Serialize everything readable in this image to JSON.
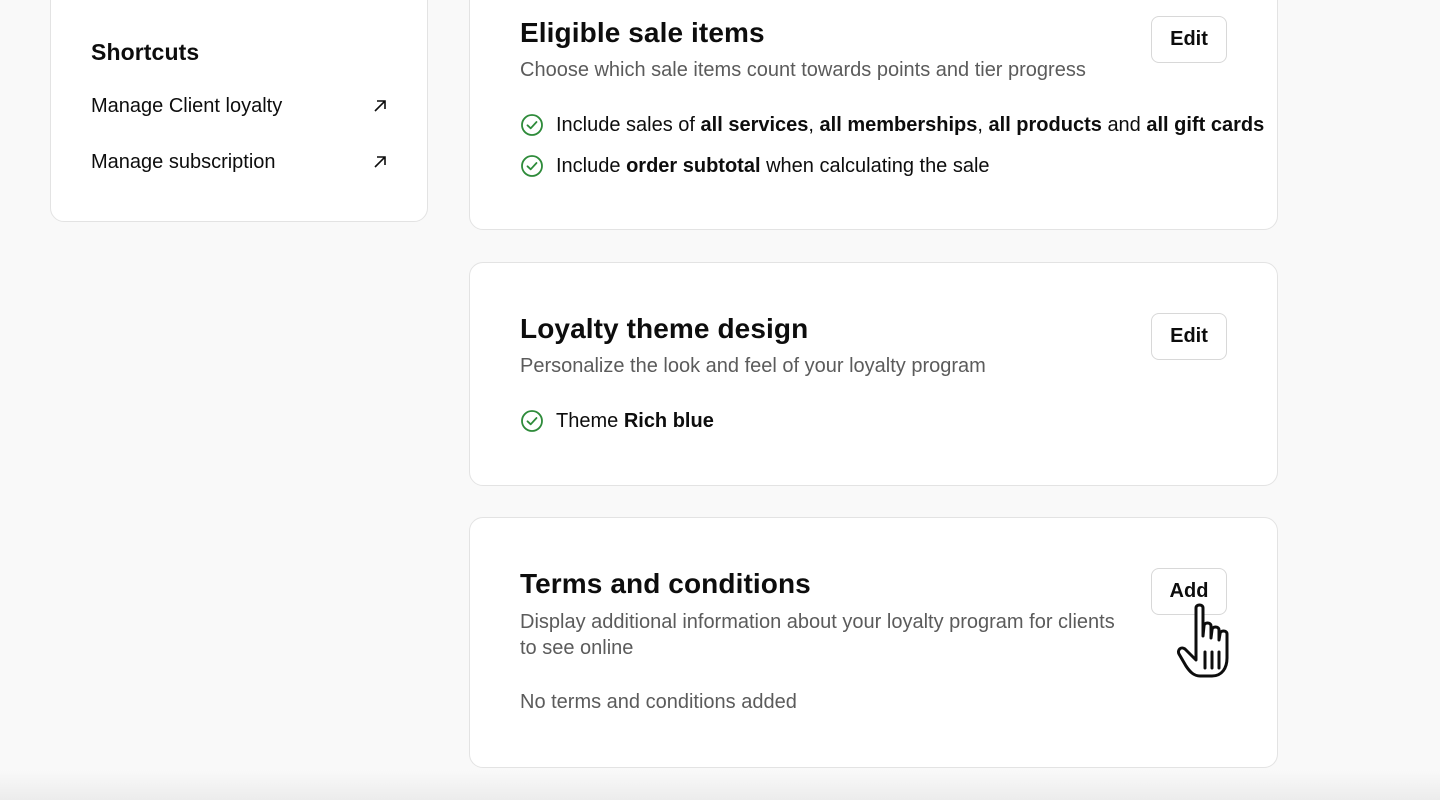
{
  "shortcuts": {
    "title": "Shortcuts",
    "items": [
      {
        "label": "Manage Client loyalty",
        "icon": "external-link-icon"
      },
      {
        "label": "Manage subscription",
        "icon": "external-link-icon"
      }
    ]
  },
  "eligible": {
    "title": "Eligible sale items",
    "description": "Choose which sale items count towards points and tier progress",
    "button": "Edit",
    "row1": {
      "prefix": "Include sales of",
      "services": "all services",
      "sep1": ",",
      "memberships": "all memberships",
      "sep2": ",",
      "products": "all products",
      "and": "and",
      "gift_cards": "all gift cards"
    },
    "row2": {
      "prefix": "Include",
      "bold": "order subtotal",
      "suffix": "when calculating the sale"
    }
  },
  "theme": {
    "title": "Loyalty theme design",
    "description": "Personalize the look and feel of your loyalty program",
    "button": "Edit",
    "row": {
      "prefix": "Theme",
      "value": "Rich blue"
    }
  },
  "terms": {
    "title": "Terms and conditions",
    "description": "Display additional information about your loyalty program for clients to see online",
    "button": "Add",
    "empty_text": "No terms and conditions added"
  },
  "colors": {
    "check_green": "#2e8b3a",
    "text_primary": "#0d0d0d",
    "text_secondary": "#5b5b5b"
  }
}
